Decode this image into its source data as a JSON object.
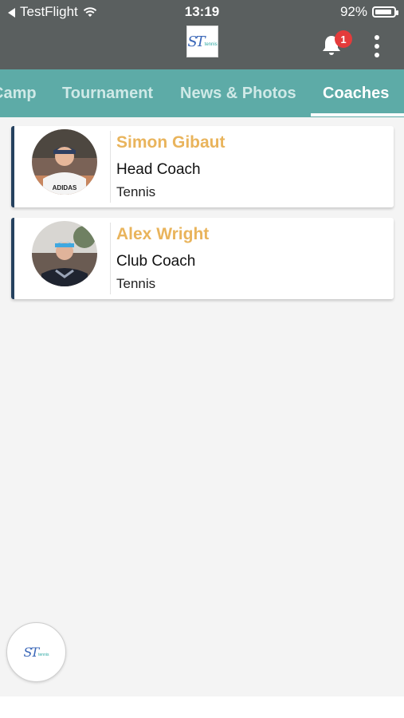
{
  "status_bar": {
    "back_app": "TestFlight",
    "time": "13:19",
    "battery": "92%",
    "battery_level": 0.92
  },
  "app_bar": {
    "logo_mark": "ST",
    "logo_text": "tennis",
    "notification_count": "1",
    "icons": [
      "bell-icon",
      "more-vert-icon"
    ]
  },
  "tabs": [
    {
      "label": "Camp",
      "active": false
    },
    {
      "label": "Tournament",
      "active": false
    },
    {
      "label": "News & Photos",
      "active": false
    },
    {
      "label": "Coaches",
      "active": true
    }
  ],
  "coaches": [
    {
      "name": "Simon Gibaut",
      "role": "Head Coach",
      "sport": "Tennis",
      "shirt_text": "ADIDAS"
    },
    {
      "name": "Alex Wright",
      "role": "Club Coach",
      "sport": "Tennis"
    }
  ],
  "fab": {
    "logo_mark": "ST",
    "logo_text": "tennis"
  },
  "colors": {
    "appbar": "#5a5f5f",
    "tabs": "#5daba7",
    "name_accent": "#e9b45c",
    "card_border": "#25415f",
    "badge": "#e43b3b"
  }
}
